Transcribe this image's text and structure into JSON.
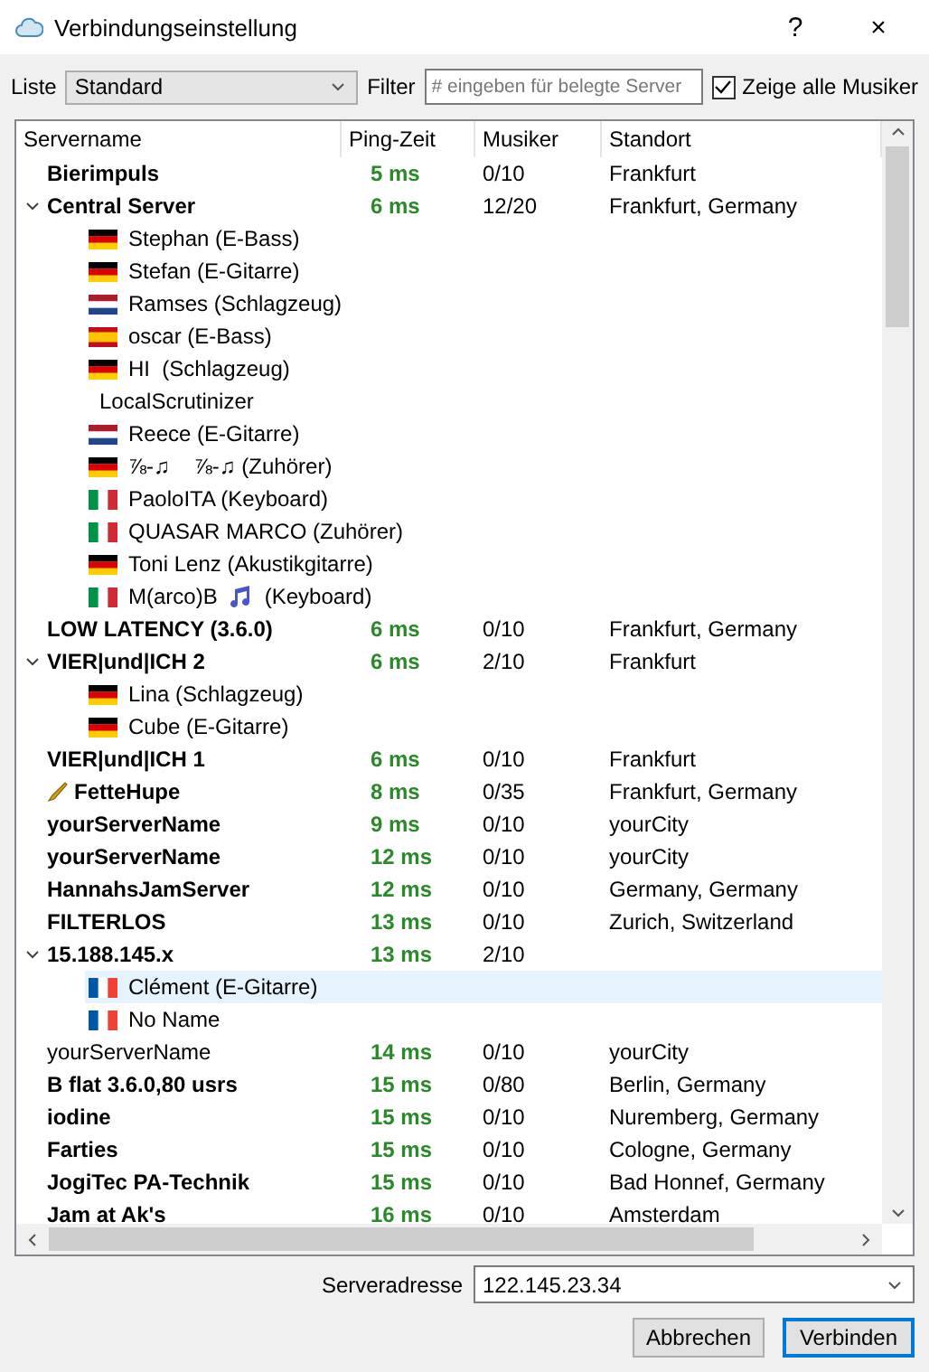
{
  "window": {
    "title": "Verbindungseinstellung",
    "help": "?",
    "close": "×"
  },
  "toolbar": {
    "list_label": "Liste",
    "list_value": "Standard",
    "filter_label": "Filter",
    "filter_placeholder": "# eingeben für belegte Server",
    "show_all": {
      "label": "Zeige alle Musiker",
      "checked": true
    }
  },
  "table": {
    "columns": [
      "Servername",
      "Ping-Zeit",
      "Musiker",
      "Standort"
    ],
    "rows": [
      {
        "kind": "server",
        "name": "Bierimpuls",
        "bold": true,
        "ping": "5 ms",
        "musicians": "0/10",
        "location": "Frankfurt",
        "selected": false
      },
      {
        "kind": "server",
        "name": "Central Server",
        "bold": true,
        "expanded": true,
        "ping": "6 ms",
        "musicians": "12/20",
        "location": "Frankfurt, Germany",
        "selected": false,
        "children": [
          {
            "kind": "de",
            "name": "Stephan (E-Bass)",
            "selected": false
          },
          {
            "kind": "de",
            "name": "Stefan (E-Gitarre)",
            "selected": false
          },
          {
            "kind": "nl",
            "name": "Ramses (Schlagzeug)",
            "selected": false
          },
          {
            "kind": "es",
            "name": "oscar (E-Bass)",
            "selected": false
          },
          {
            "kind": "de",
            "name": "HI  (Schlagzeug)",
            "selected": false
          },
          {
            "kind": "none",
            "name": "LocalScrutinizer",
            "selected": false
          },
          {
            "kind": "nl",
            "name": "Reece (E-Gitarre)",
            "selected": false
          },
          {
            "kind": "de",
            "name": "⅞-♫    ⅞-♫ (Zuhörer)",
            "selected": false
          },
          {
            "kind": "it",
            "name": "PaoloITA (Keyboard)",
            "selected": false
          },
          {
            "kind": "it",
            "name": "QUASAR MARCO (Zuhörer)",
            "selected": false
          },
          {
            "kind": "de",
            "name": "Toni Lenz (Akustikgitarre)",
            "selected": false
          },
          {
            "kind": "it",
            "name": "M(arco)B",
            "after_note": "(Keyboard)",
            "selected": false
          }
        ]
      },
      {
        "kind": "server",
        "name": "LOW LATENCY (3.6.0)",
        "bold": true,
        "ping": "6 ms",
        "musicians": "0/10",
        "location": "Frankfurt, Germany",
        "selected": false
      },
      {
        "kind": "server",
        "name": "VIER|und|ICH 2",
        "bold": true,
        "expanded": true,
        "ping": "6 ms",
        "musicians": "2/10",
        "location": "Frankfurt",
        "selected": false,
        "children": [
          {
            "kind": "de",
            "name": "Lina (Schlagzeug)",
            "selected": false
          },
          {
            "kind": "de",
            "name": "Cube (E-Gitarre)",
            "selected": false
          }
        ]
      },
      {
        "kind": "server",
        "name": "VIER|und|ICH 1",
        "bold": true,
        "ping": "6 ms",
        "musicians": "0/10",
        "location": "Frankfurt",
        "selected": false
      },
      {
        "kind": "server",
        "name": "FetteHupe",
        "bold": true,
        "horn": true,
        "ping": "8 ms",
        "musicians": "0/35",
        "location": "Frankfurt, Germany",
        "selected": false
      },
      {
        "kind": "server",
        "name": "yourServerName",
        "bold": true,
        "ping": "9 ms",
        "musicians": "0/10",
        "location": "yourCity",
        "selected": false
      },
      {
        "kind": "server",
        "name": "yourServerName",
        "bold": true,
        "ping": "12 ms",
        "musicians": "0/10",
        "location": "yourCity",
        "selected": false
      },
      {
        "kind": "server",
        "name": "HannahsJamServer",
        "bold": true,
        "ping": "12 ms",
        "musicians": "0/10",
        "location": "Germany, Germany",
        "selected": false
      },
      {
        "kind": "server",
        "name": "FILTERLOS",
        "bold": true,
        "ping": "13 ms",
        "musicians": "0/10",
        "location": "Zurich, Switzerland",
        "selected": false
      },
      {
        "kind": "server",
        "name": "15.188.145.x",
        "bold": true,
        "expanded": true,
        "ping": "13 ms",
        "musicians": "2/10",
        "selected": false,
        "children": [
          {
            "kind": "fr",
            "name": "Clément (E-Gitarre)",
            "selected": true
          },
          {
            "kind": "fr",
            "name": "No Name",
            "selected": false
          }
        ]
      },
      {
        "kind": "server",
        "name": "yourServerName",
        "bold": false,
        "ping": "14 ms",
        "musicians": "0/10",
        "location": "yourCity",
        "selected": false
      },
      {
        "kind": "server",
        "name": "B flat 3.6.0,80 usrs",
        "bold": true,
        "ping": "15 ms",
        "musicians": "0/80",
        "location": "Berlin, Germany",
        "selected": false
      },
      {
        "kind": "server",
        "name": "iodine",
        "bold": true,
        "ping": "15 ms",
        "musicians": "0/10",
        "location": "Nuremberg, Germany",
        "selected": false
      },
      {
        "kind": "server",
        "name": "Farties",
        "bold": true,
        "ping": "15 ms",
        "musicians": "0/10",
        "location": "Cologne, Germany",
        "selected": false
      },
      {
        "kind": "server",
        "name": "JogiTec PA-Technik",
        "bold": true,
        "ping": "15 ms",
        "musicians": "0/10",
        "location": "Bad Honnef, Germany",
        "selected": false
      },
      {
        "kind": "server",
        "name": "Jam at Ak's",
        "bold": true,
        "ping": "16 ms",
        "musicians": "0/10",
        "location": "Amsterdam",
        "selected": false
      }
    ]
  },
  "address": {
    "label": "Serveradresse",
    "value": "122.145.23.34"
  },
  "buttons": [
    {
      "label": "Abbrechen",
      "default": false
    },
    {
      "label": "Verbinden",
      "default": true
    }
  ]
}
